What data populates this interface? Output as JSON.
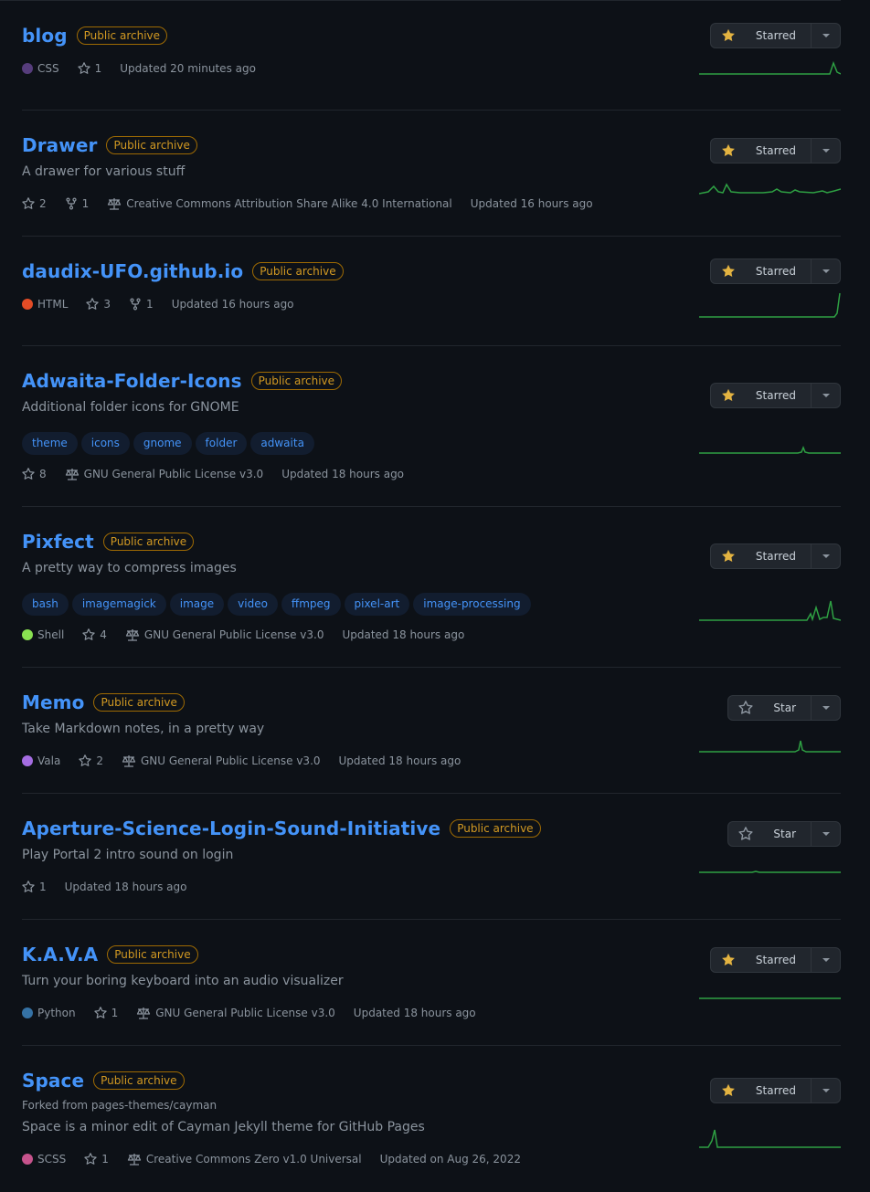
{
  "repos": [
    {
      "name": "blog",
      "badge": "Public archive",
      "language": "CSS",
      "lang_color": "#563d7c",
      "stars": "1",
      "updated": "Updated 20 minutes ago",
      "star_label": "Starred",
      "starred": true
    },
    {
      "name": "Drawer",
      "badge": "Public archive",
      "description": "A drawer for various stuff",
      "stars": "2",
      "forks": "1",
      "license": "Creative Commons Attribution Share Alike 4.0 International",
      "updated": "Updated 16 hours ago",
      "star_label": "Starred",
      "starred": true
    },
    {
      "name": "daudix-UFO.github.io",
      "badge": "Public archive",
      "language": "HTML",
      "lang_color": "#e34c26",
      "stars": "3",
      "forks": "1",
      "updated": "Updated 16 hours ago",
      "star_label": "Starred",
      "starred": true
    },
    {
      "name": "Adwaita-Folder-Icons",
      "badge": "Public archive",
      "description": "Additional folder icons for GNOME",
      "topics": [
        "theme",
        "icons",
        "gnome",
        "folder",
        "adwaita"
      ],
      "stars": "8",
      "license": "GNU General Public License v3.0",
      "updated": "Updated 18 hours ago",
      "star_label": "Starred",
      "starred": true
    },
    {
      "name": "Pixfect",
      "badge": "Public archive",
      "description": "A pretty way to compress images",
      "topics": [
        "bash",
        "imagemagick",
        "image",
        "video",
        "ffmpeg",
        "pixel-art",
        "image-processing"
      ],
      "language": "Shell",
      "lang_color": "#89e051",
      "stars": "4",
      "license": "GNU General Public License v3.0",
      "updated": "Updated 18 hours ago",
      "star_label": "Starred",
      "starred": true
    },
    {
      "name": "Memo",
      "badge": "Public archive",
      "description": "Take Markdown notes, in a pretty way",
      "language": "Vala",
      "lang_color": "#a56de2",
      "stars": "2",
      "license": "GNU General Public License v3.0",
      "updated": "Updated 18 hours ago",
      "star_label": "Star",
      "starred": false
    },
    {
      "name": "Aperture-Science-Login-Sound-Initiative",
      "badge": "Public archive",
      "description": "Play Portal 2 intro sound on login",
      "stars": "1",
      "updated": "Updated 18 hours ago",
      "star_label": "Star",
      "starred": false
    },
    {
      "name": "K.A.V.A",
      "badge": "Public archive",
      "description": "Turn your boring keyboard into an audio visualizer",
      "language": "Python",
      "lang_color": "#3572a5",
      "stars": "1",
      "license": "GNU General Public License v3.0",
      "updated": "Updated 18 hours ago",
      "star_label": "Starred",
      "starred": true
    },
    {
      "name": "Space",
      "badge": "Public archive",
      "forked_from": "Forked from pages-themes/cayman",
      "description": "Space is a minor edit of Cayman Jekyll theme for GitHub Pages",
      "language": "SCSS",
      "lang_color": "#c6538c",
      "stars": "1",
      "license": "Creative Commons Zero v1.0 Universal",
      "updated": "Updated on Aug 26, 2022",
      "star_label": "Starred",
      "starred": true
    }
  ],
  "icons": {
    "star": "star-icon",
    "fork": "repo-forked-icon",
    "license": "law-icon",
    "caret": "triangle-down-icon"
  },
  "colors": {
    "link": "#4493f8",
    "archive_badge": "#d29922",
    "starred_icon": "#e3b341",
    "sparkline": "#2ea043"
  }
}
